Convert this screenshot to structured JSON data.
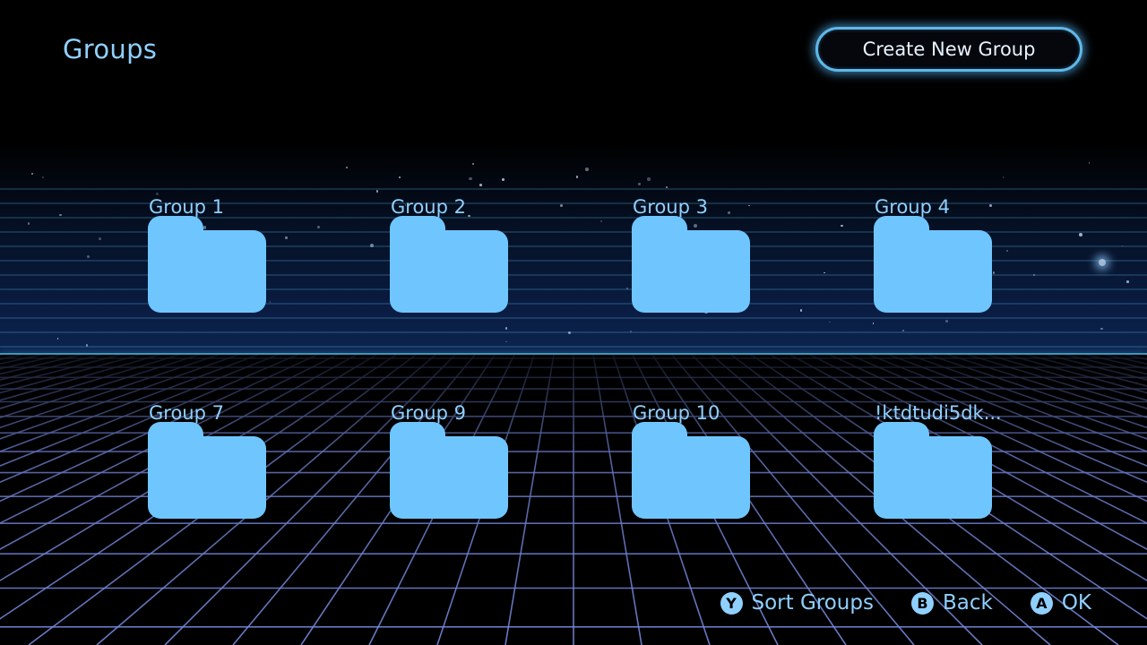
{
  "header": {
    "title": "Groups",
    "create_label": "Create New Group"
  },
  "groups": [
    {
      "label": "Group 1"
    },
    {
      "label": "Group 2"
    },
    {
      "label": "Group 3"
    },
    {
      "label": "Group 4"
    },
    {
      "label": "Group 7"
    },
    {
      "label": "Group 9"
    },
    {
      "label": "Group 10"
    },
    {
      "label": "!ktdtudi5dk..."
    }
  ],
  "footer": {
    "hints": [
      {
        "button": "Y",
        "label": "Sort Groups"
      },
      {
        "button": "B",
        "label": "Back"
      },
      {
        "button": "A",
        "label": "OK"
      }
    ]
  },
  "colors": {
    "accent": "#8fd0ff",
    "folder": "#6fc6ff",
    "grid": "#7a8fe8",
    "background": "#000000"
  },
  "icons": {
    "folder": "folder-icon"
  }
}
